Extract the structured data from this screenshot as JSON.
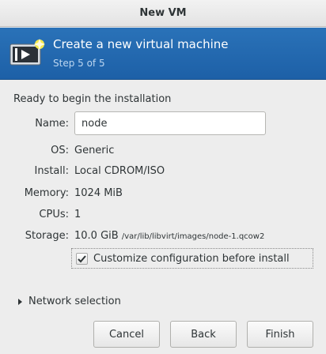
{
  "window": {
    "title": "New VM"
  },
  "header": {
    "title": "Create a new virtual machine",
    "step": "Step 5 of 5"
  },
  "summary": {
    "heading": "Ready to begin the installation",
    "name_label": "Name:",
    "name_value": "node",
    "os_label": "OS:",
    "os_value": "Generic",
    "install_label": "Install:",
    "install_value": "Local CDROM/ISO",
    "memory_label": "Memory:",
    "memory_value": "1024 MiB",
    "cpus_label": "CPUs:",
    "cpus_value": "1",
    "storage_label": "Storage:",
    "storage_value": "10.0 GiB",
    "storage_path": "/var/lib/libvirt/images/node-1.qcow2"
  },
  "customize": {
    "label": "Customize configuration before install",
    "checked": true
  },
  "network": {
    "label": "Network selection"
  },
  "buttons": {
    "cancel": "Cancel",
    "back": "Back",
    "finish": "Finish"
  },
  "colors": {
    "header_bg": "#2066ad",
    "header_step": "#bcd6f0"
  }
}
